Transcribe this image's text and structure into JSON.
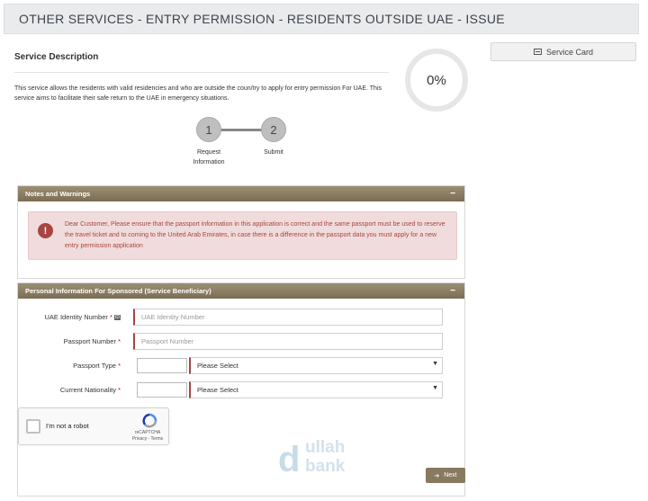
{
  "header": {
    "title": "OTHER SERVICES - ENTRY PERMISSION - RESIDENTS OUTSIDE UAE - ISSUE"
  },
  "service": {
    "title": "Service Description",
    "description": "This service allows the residents with valid residencies and who are outside the coun/try to apply for entry permission For UAE. This service aims to facilitate their safe return to the UAE in emergency situations."
  },
  "progress": {
    "label": "0%",
    "value": 0
  },
  "service_card": {
    "label": "Service Card",
    "icon": "card-icon"
  },
  "stepper": {
    "steps": [
      {
        "number": "1",
        "label": "Request Information"
      },
      {
        "number": "2",
        "label": "Submit"
      }
    ]
  },
  "notes_panel": {
    "title": "Notes and Warnings",
    "collapse": "−",
    "alert_icon": "!",
    "alert_text": "Dear Customer, Please ensure that the passport information in this application is correct and the same passport must be used to reserve the travel ticket and to coming to the United Arab Emirates, in case there is a difference in the passport data you must apply for a new entry permission application"
  },
  "personal_panel": {
    "title": "Personal Information For Sponsored (Service Beneficiary)",
    "collapse": "−",
    "required_mark": "*",
    "id_badge": "ID",
    "fields": {
      "uae_id": {
        "label": "UAE Identity Number",
        "placeholder": "UAE Identity Number"
      },
      "passport_number": {
        "label": "Passport Number",
        "placeholder": "Passport Number"
      },
      "passport_type": {
        "label": "Passport Type",
        "value": "Please Select"
      },
      "nationality": {
        "label": "Current Nationality",
        "value": "Please Select"
      }
    },
    "captcha": {
      "label": "I'm not a robot",
      "brand": "reCAPTCHA",
      "links": "Privacy - Terms"
    },
    "next": {
      "label": "Next",
      "icon": "arrow-right-icon"
    }
  },
  "watermark": {
    "line1": "ullah",
    "line2": "bank",
    "letter": "d"
  }
}
